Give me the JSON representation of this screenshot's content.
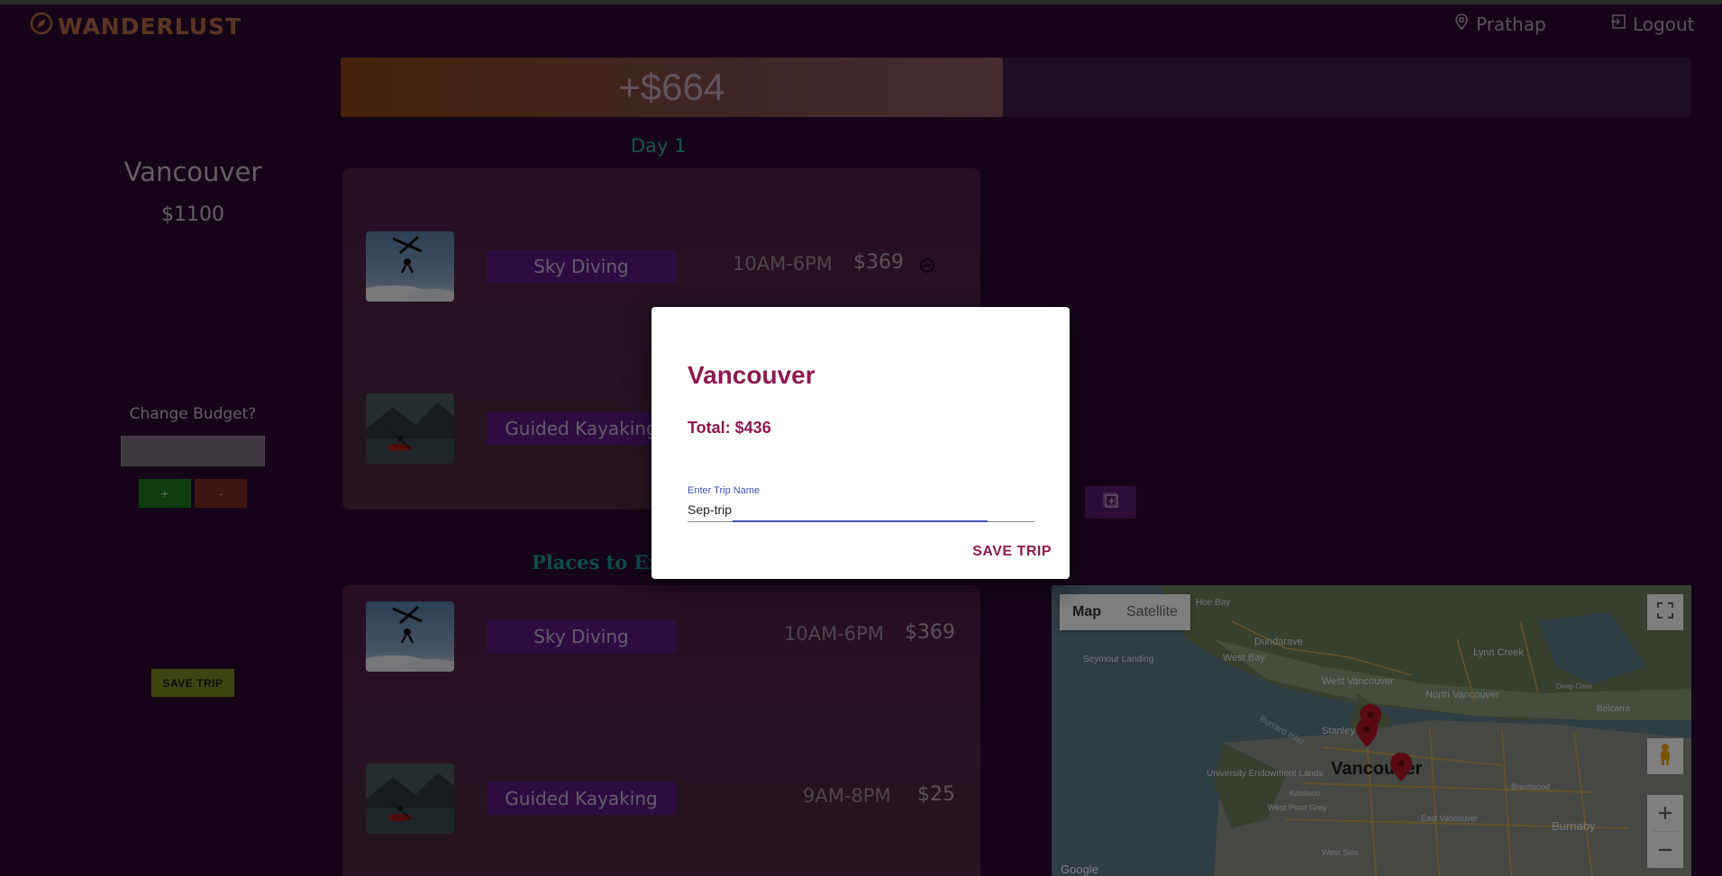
{
  "header": {
    "logo_text": "WANDERLUST",
    "user_name": "Prathap",
    "logout_label": "Logout"
  },
  "budget_bar": {
    "label": "+$664",
    "fill_fraction": 0.49
  },
  "sidebar": {
    "city": "Vancouver",
    "budget": "$1100",
    "change_budget_label": "Change Budget?",
    "plus_label": "+",
    "minus_label": "-",
    "save_trip_label": "SAVE TRIP"
  },
  "day": {
    "title": "Day 1",
    "activities": [
      {
        "name": "Sky Diving",
        "time": "10AM-6PM",
        "price": "$369",
        "image": "skydiving"
      },
      {
        "name": "Guided Kayaking",
        "time": "",
        "price": "",
        "image": "kayaking"
      }
    ]
  },
  "places": {
    "title": "Places to Explore",
    "items": [
      {
        "name": "Sky Diving",
        "time": "10AM-6PM",
        "price": "$369",
        "image": "skydiving"
      },
      {
        "name": "Guided Kayaking",
        "time": "9AM-8PM",
        "price": "$25",
        "image": "kayaking"
      }
    ]
  },
  "map": {
    "map_label": "Map",
    "satellite_label": "Satellite",
    "city_label": "Vancouver",
    "places": [
      "West Bay",
      "Dundarave",
      "West Vancouver",
      "Lynn Creek",
      "North Vancouver",
      "Seymour Landing",
      "Stanley Park",
      "Burrard Inlet",
      "University Endowment Lands",
      "Kitsilano",
      "West Point Grey",
      "East Vancouver",
      "Burnaby",
      "Belcarra",
      "Deep Cove",
      "Brentwood",
      "West Side",
      "Hoe Bay"
    ],
    "google_label": "Google"
  },
  "modal": {
    "title": "Vancouver",
    "total": "Total: $436",
    "input_label": "Enter Trip Name",
    "input_value": "Sep-trip",
    "save_label": "SAVE TRIP"
  },
  "colors": {
    "background": "#2a0830",
    "accent": "#8b1a50",
    "pill": "#5a1a82",
    "teal": "#38a3a8"
  }
}
